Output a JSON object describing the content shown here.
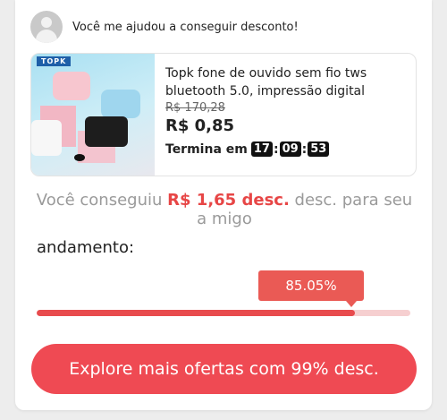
{
  "header": {
    "message": "Você me ajudou a conseguir desconto!"
  },
  "product": {
    "brand": "TOPK",
    "title": "Topk fone de ouvido sem fio tws bluetooth 5.0, impressão digital",
    "original_price": "R$ 170,28",
    "price": "R$ 0,85",
    "timer_label": "Termina em",
    "timer": {
      "hours": "17",
      "minutes": "09",
      "seconds": "53",
      "separator": ":"
    }
  },
  "summary": {
    "prefix": "Você conseguiu ",
    "amount": "R$ 1,65 desc.",
    "suffix": " desc. para seu a migo"
  },
  "progress": {
    "label": "andamento:",
    "percent_text": "85.05%",
    "value": 0.8505
  },
  "cta": {
    "label": "Explore mais ofertas com 99% desc."
  },
  "colors": {
    "accent": "#ef4a53",
    "progress_fill": "#e84b4d",
    "progress_track": "#f6cfd0"
  }
}
